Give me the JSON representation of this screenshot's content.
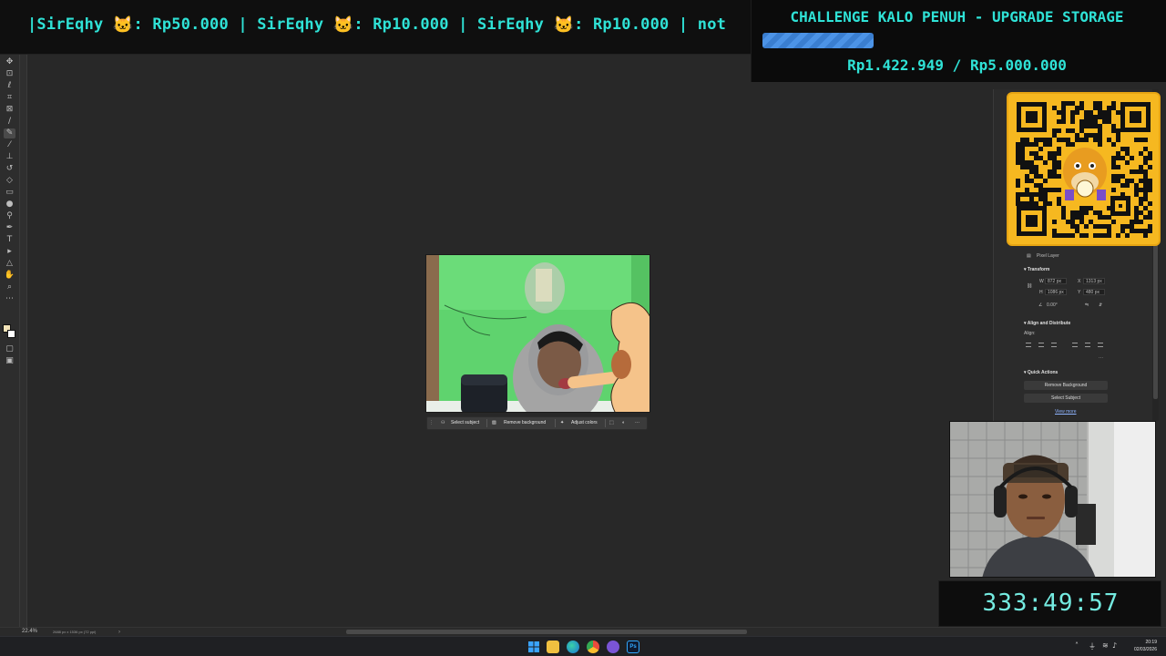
{
  "ticker": {
    "parts": [
      {
        "name": "|SirEqhy",
        "sep": ": ",
        "amount": "Rp50.000"
      },
      {
        "name": " | SirEqhy",
        "sep": ": ",
        "amount": "Rp10.000"
      },
      {
        "name": " | SirEqhy",
        "sep": ": ",
        "amount": "Rp10.000"
      }
    ],
    "tail": " | not",
    "mascot_glyph": "🐱"
  },
  "challenge": {
    "title": "CHALLENGE KALO PENUH - UPGRADE STORAGE",
    "amount_text": "Rp1.422.949 / Rp5.000.000",
    "progress_fraction": 0.2846,
    "fill_color": "#3f86da"
  },
  "properties_panel": {
    "layer_type": "Pixel Layer",
    "transform_heading": "Transform",
    "w_label": "W",
    "w_value": "872 px",
    "x_label": "X",
    "x_value": "1313 px",
    "h_label": "H",
    "h_value": "1086 px",
    "y_label": "Y",
    "y_value": "480 px",
    "angle_value": "0.00°",
    "align_heading": "Align and Distribute",
    "align_label": "Align:",
    "quick_actions_heading": "Quick Actions",
    "remove_background": "Remove Background",
    "select_subject": "Select Subject",
    "view_more": "View more",
    "more_dots": "···"
  },
  "context_bar": {
    "select_subject": "Select subject",
    "remove_background": "Remove background",
    "adjust_colors": "Adjust colors",
    "more": "···"
  },
  "timer": {
    "text": "333:49:57"
  },
  "status": {
    "zoom": "22.4%",
    "dimensions": "2688 px x 1536 px (72 ppi)"
  },
  "taskbar": {
    "time": "20:19",
    "date": "02/03/2026"
  },
  "colors": {
    "accent_cyan": "#2fe2d6",
    "qr_background": "#f6b820",
    "app_background": "#282828"
  },
  "icons": {
    "toolbar": [
      "move-icon",
      "artboard-icon",
      "lasso-icon",
      "quick-select-icon",
      "crop-icon",
      "frame-icon",
      "eyedropper-icon",
      "healing-brush-icon",
      "brush-icon",
      "clone-stamp-icon",
      "history-brush-icon",
      "eraser-icon",
      "gradient-icon",
      "blur-icon",
      "dodge-icon",
      "pen-icon",
      "type-icon",
      "path-select-icon",
      "shape-icon",
      "hand-icon",
      "zoom-icon",
      "more-tools-icon"
    ]
  }
}
